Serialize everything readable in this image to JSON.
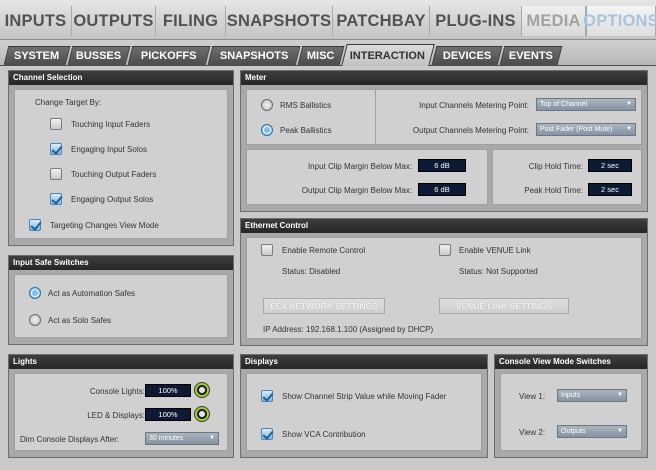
{
  "top_tabs": [
    "INPUTS",
    "OUTPUTS",
    "FILING",
    "SNAPSHOTS",
    "PATCHBAY",
    "PLUG-INS",
    "MEDIA",
    "OPTIONS"
  ],
  "sub_tabs": [
    "SYSTEM",
    "BUSSES",
    "PICKOFFS",
    "SNAPSHOTS",
    "MISC",
    "INTERACTION",
    "DEVICES",
    "EVENTS"
  ],
  "channel_selection": {
    "title": "Channel Selection",
    "heading": "Change Target By:",
    "items": [
      {
        "label": "Touching Input Faders",
        "checked": false
      },
      {
        "label": "Engaging Input Solos",
        "checked": true
      },
      {
        "label": "Touching Output Faders",
        "checked": false
      },
      {
        "label": "Engaging Output Solos",
        "checked": true
      }
    ],
    "view_mode_label": "Targeting Changes View Mode",
    "view_mode_checked": true
  },
  "input_safe": {
    "title": "Input Safe Switches",
    "options": [
      {
        "label": "Act as Automation Safes",
        "selected": true
      },
      {
        "label": "Act as Solo Safes",
        "selected": false
      }
    ]
  },
  "lights": {
    "title": "Lights",
    "console_lights_label": "Console Lights:",
    "console_lights_value": "100%",
    "led_label": "LED & Displays:",
    "led_value": "100%",
    "dim_label": "Dim Console Displays After:",
    "dim_value": "30 minutes"
  },
  "meter": {
    "title": "Meter",
    "ballistics": [
      {
        "label": "RMS Ballistics",
        "selected": false
      },
      {
        "label": "Peak Ballistics",
        "selected": true
      }
    ],
    "input_point_label": "Input Channels Metering Point:",
    "input_point_value": "Top of Channel",
    "output_point_label": "Output Channels Metering Point:",
    "output_point_value": "Post Fader (Post Mute)",
    "input_clip_label": "Input Clip Margin Below Max:",
    "input_clip_value": "6 dB",
    "output_clip_label": "Output Clip Margin Below Max:",
    "output_clip_value": "6 dB",
    "clip_hold_label": "Clip Hold Time:",
    "clip_hold_value": "2 sec",
    "peak_hold_label": "Peak Hold Time:",
    "peak_hold_value": "2 sec"
  },
  "ethernet": {
    "title": "Ethernet Control",
    "remote_label": "Enable Remote Control",
    "remote_status": "Status:  Disabled",
    "venue_label": "Enable VENUE Link",
    "venue_status": "Status:  Not Supported",
    "ecx_button": "ECx NETWORK SETTINGS",
    "venue_button": "VENUE LINK SETTINGS",
    "ip_text": "IP Address:  192.168.1.100 (Assigned by DHCP)"
  },
  "displays": {
    "title": "Displays",
    "strip_label": "Show Channel Strip Value while Moving Fader",
    "strip_checked": true,
    "vca_label": "Show VCA Contribution",
    "vca_checked": true
  },
  "console_view": {
    "title": "Console View Mode Switches",
    "view1_label": "View 1:",
    "view1_value": "Inputs",
    "view2_label": "View 2:",
    "view2_value": "Outputs"
  },
  "colors": {
    "active_tab_text": "#a9c4de",
    "panel_header": "#2e2e2e",
    "value_box": "#0c1a33",
    "knob_ring": "#9ccf2d"
  }
}
